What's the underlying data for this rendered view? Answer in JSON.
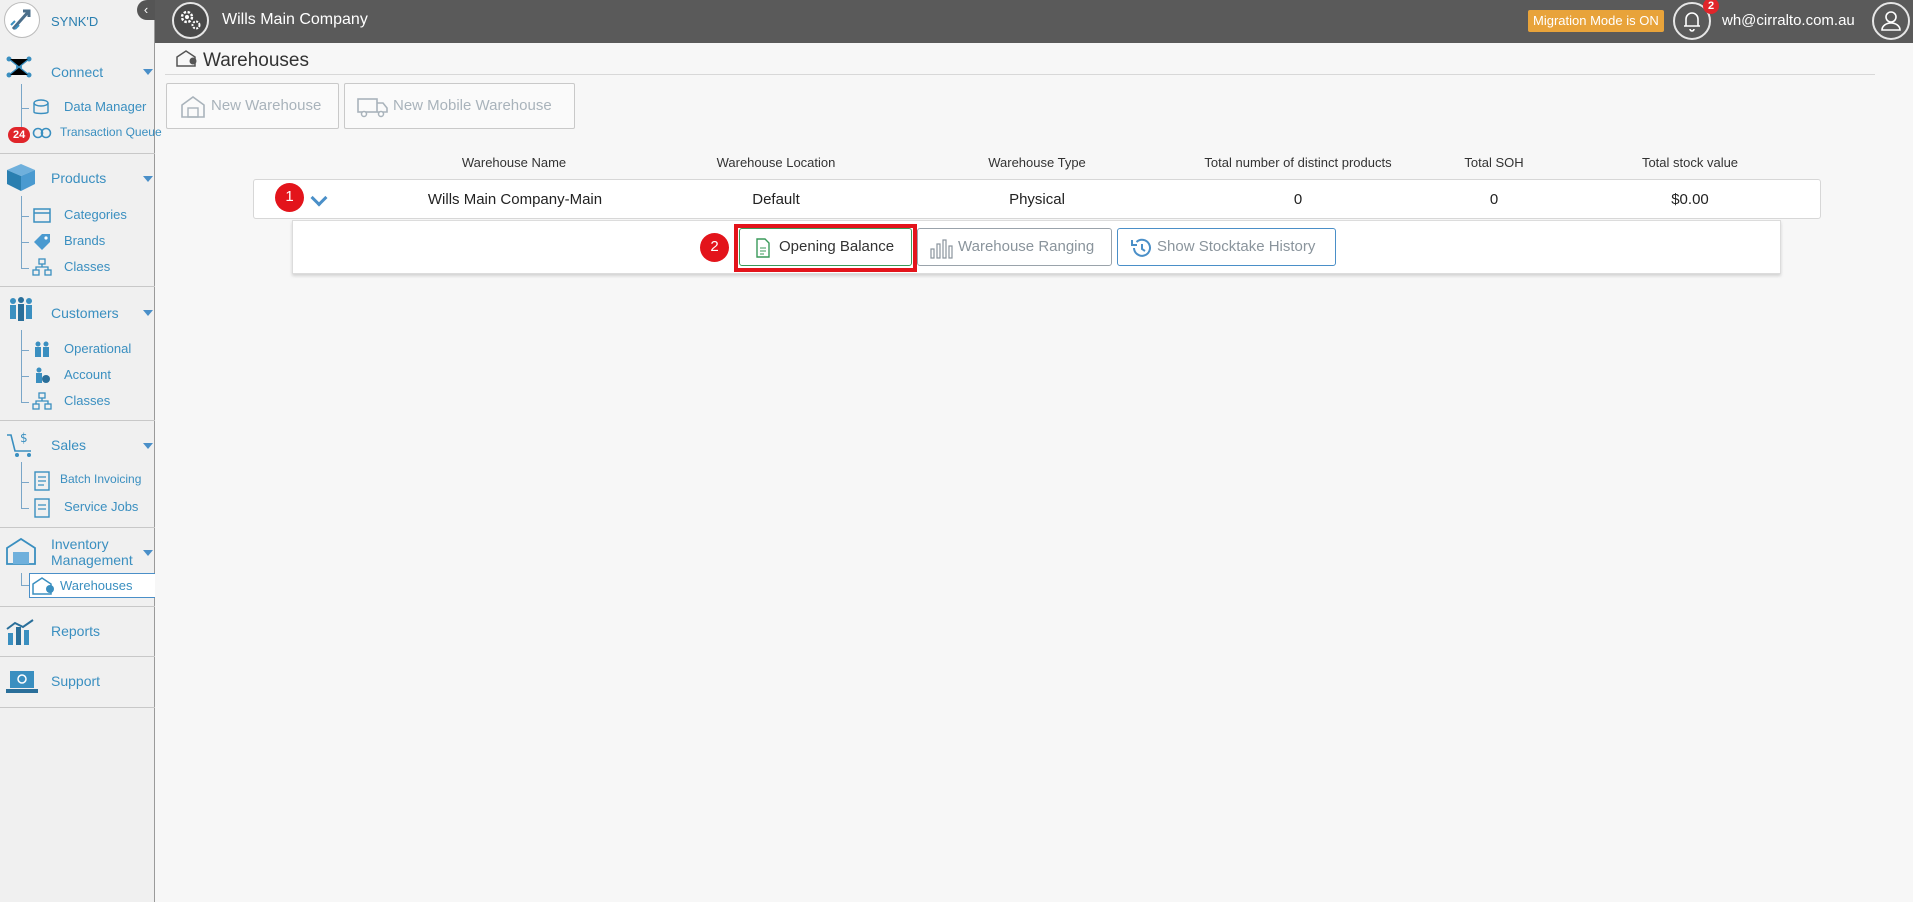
{
  "app": {
    "brand": "SYNK'D",
    "company": "Wills Main Company",
    "migration_label": "Migration Mode is ON",
    "notification_count": "2",
    "user_email": "wh@cirralto.com.au"
  },
  "sidebar": {
    "sections": [
      {
        "label": "Connect",
        "items": [
          {
            "label": "Data Manager"
          },
          {
            "label": "Transaction Queue",
            "badge": "24"
          }
        ]
      },
      {
        "label": "Products",
        "items": [
          {
            "label": "Categories"
          },
          {
            "label": "Brands"
          },
          {
            "label": "Classes"
          }
        ]
      },
      {
        "label": "Customers",
        "items": [
          {
            "label": "Operational"
          },
          {
            "label": "Account"
          },
          {
            "label": "Classes"
          }
        ]
      },
      {
        "label": "Sales",
        "items": [
          {
            "label": "Batch Invoicing"
          },
          {
            "label": "Service Jobs"
          }
        ]
      },
      {
        "label": "Inventory Management",
        "items": [
          {
            "label": "Warehouses",
            "active": true
          }
        ]
      },
      {
        "label": "Reports"
      },
      {
        "label": "Support"
      }
    ]
  },
  "page": {
    "title": "Warehouses",
    "toolbar": {
      "new_warehouse": "New Warehouse",
      "new_mobile_warehouse": "New Mobile Warehouse"
    }
  },
  "table": {
    "columns": [
      "Warehouse Name",
      "Warehouse Location",
      "Warehouse Type",
      "Total number of distinct products",
      "Total SOH",
      "Total stock value"
    ],
    "rows": [
      {
        "name": "Wills Main Company-Main",
        "location": "Default",
        "type": "Physical",
        "distinct_products": "0",
        "soh": "0",
        "stock_value": "$0.00"
      }
    ]
  },
  "actions": {
    "opening_balance": "Opening Balance",
    "warehouse_ranging": "Warehouse Ranging",
    "stocktake_history": "Show Stocktake History"
  },
  "annotations": {
    "step1": "1",
    "step2": "2"
  },
  "colors": {
    "accent": "#3a8fc0",
    "topbar": "#5a5a5a",
    "migration": "#e8a33a",
    "annotation_red": "#e3141b"
  }
}
